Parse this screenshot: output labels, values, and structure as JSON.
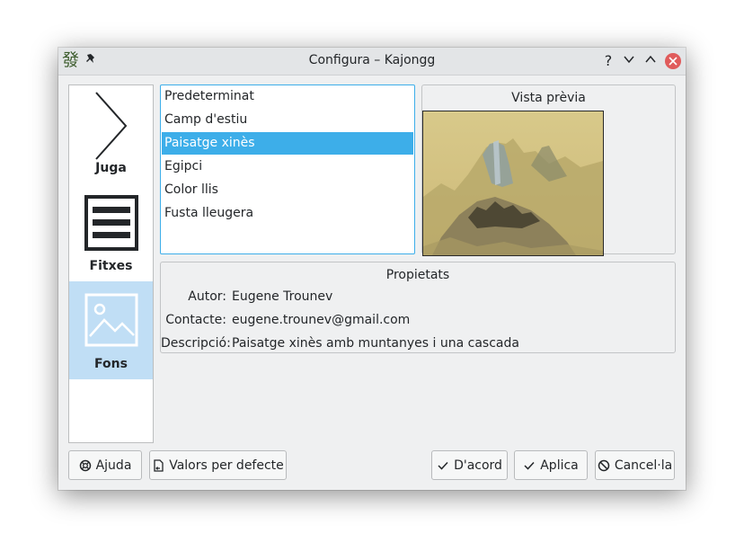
{
  "window": {
    "title": "Configura – Kajongg",
    "app_icon_glyph": "發",
    "help_glyph": "?",
    "minimize_glyph": "⌄",
    "maximize_glyph": "⌃"
  },
  "sidebar": {
    "items": [
      {
        "label": "Juga",
        "icon": "chevron-right-icon"
      },
      {
        "label": "Fitxes",
        "icon": "tiles-icon"
      },
      {
        "label": "Fons",
        "icon": "image-icon",
        "selected": true
      }
    ]
  },
  "backgrounds": {
    "items": [
      {
        "label": "Predeterminat"
      },
      {
        "label": "Camp d'estiu"
      },
      {
        "label": "Paisatge xinès",
        "selected": true
      },
      {
        "label": "Egipci"
      },
      {
        "label": "Color llis"
      },
      {
        "label": "Fusta lleugera"
      }
    ]
  },
  "preview": {
    "title": "Vista prèvia"
  },
  "properties": {
    "title": "Propietats",
    "author_label": "Autor:",
    "author_value": "Eugene Trounev",
    "contact_label": "Contacte:",
    "contact_value": "eugene.trounev@gmail.com",
    "description_label": "Descripció:",
    "description_value": "Paisatge xinès amb muntanyes i una cascada"
  },
  "buttons": {
    "help": "Ajuda",
    "defaults": "Valors per defecte",
    "ok": "D'acord",
    "apply": "Aplica",
    "cancel": "Cancel·la"
  },
  "colors": {
    "accent": "#3daee9",
    "selection_bg": "#c0def5",
    "window_bg": "#eff0f1",
    "close_button": "#e05b5b"
  }
}
